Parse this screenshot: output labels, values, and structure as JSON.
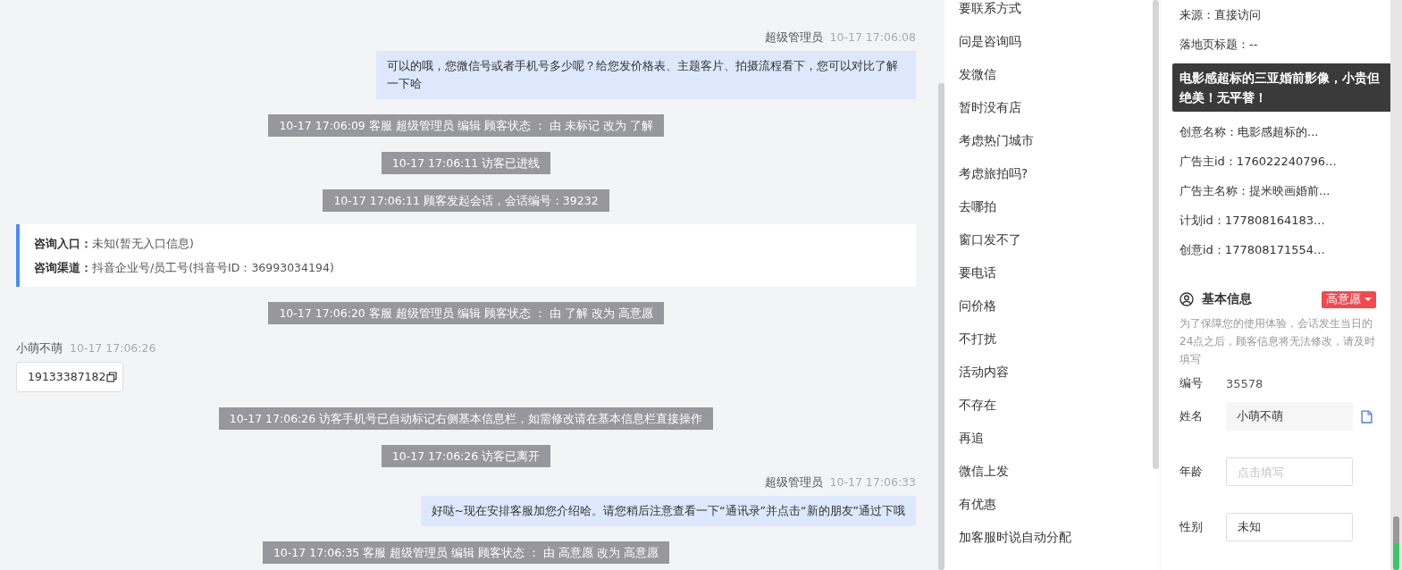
{
  "chat": {
    "messages": [
      {
        "kind": "agent",
        "name": "超级管理员",
        "time": "10-17 17:06:08",
        "text": "可以的哦，您微信号或者手机号多少呢？给您发价格表、主题客片、拍摄流程看下，您可以对比了解一下哈"
      },
      {
        "kind": "system",
        "text": "10-17 17:06:09 客服 超级管理员 编辑 顾客状态 ： 由 未标记 改为 了解"
      },
      {
        "kind": "system",
        "text": "10-17 17:06:11 访客已进线"
      },
      {
        "kind": "system",
        "text": "10-17 17:06:11 顾客发起会话，会话编号：39232"
      },
      {
        "kind": "entry",
        "lines": [
          {
            "label": "咨询入口：",
            "value": "未知(暂无入口信息)"
          },
          {
            "label": "咨询渠道：",
            "value": "抖音企业号/员工号(抖音号ID：36993034194)"
          }
        ]
      },
      {
        "kind": "system",
        "text": "10-17 17:06:20 客服 超级管理员 编辑 顾客状态 ： 由 了解 改为 高意愿"
      },
      {
        "kind": "visitor",
        "name": "小萌不萌",
        "time": "10-17 17:06:26",
        "text": "19133387182"
      },
      {
        "kind": "system",
        "text": "10-17 17:06:26 访客手机号已自动标记右侧基本信息栏，如需修改请在基本信息栏直接操作"
      },
      {
        "kind": "system",
        "text": "10-17 17:06:26 访客已离开"
      },
      {
        "kind": "agent",
        "name": "超级管理员",
        "time": "10-17 17:06:33",
        "text": "好哒~现在安排客服加您介绍哈。请您稍后注意查看一下“通讯录”并点击“新的朋友”通过下哦"
      },
      {
        "kind": "system",
        "text": "10-17 17:06:35 客服 超级管理员 编辑 顾客状态 ： 由 高意愿 改为 高意愿"
      }
    ]
  },
  "quick_replies": [
    "要联系方式",
    "问是咨询吗",
    "发微信",
    "暂时没有店",
    "考虑热门城市",
    "考虑旅拍吗?",
    "去哪拍",
    "窗口发不了",
    "要电话",
    "问价格",
    "不打扰",
    "活动内容",
    "不存在",
    "再追",
    "微信上发",
    "有优惠",
    "加客服时说自动分配"
  ],
  "source_info": [
    "来源：直接访问",
    "落地页标题：--",
    "创意名称：电影感超标的...",
    "广告主id：176022240796...",
    "广告主名称：提米映画婚前...",
    "计划id：177808164183...",
    "创意id：177808171554..."
  ],
  "tooltip": "电影感超标的三亚婚前影像，小贵但绝美！无平替！",
  "basic_info": {
    "title": "基本信息",
    "status_tag": "高意愿",
    "note": "为了保障您的使用体验，会话发生当日的24点之后，顾客信息将无法修改，请及时填写",
    "fields": [
      {
        "kind": "text",
        "label": "编号",
        "value": "35578"
      },
      {
        "kind": "readonly",
        "label": "姓名",
        "value": "小萌不萌"
      },
      {
        "kind": "input",
        "label": "年龄",
        "placeholder": "点击填写"
      },
      {
        "kind": "input",
        "label": "性别",
        "value": "未知"
      }
    ]
  }
}
